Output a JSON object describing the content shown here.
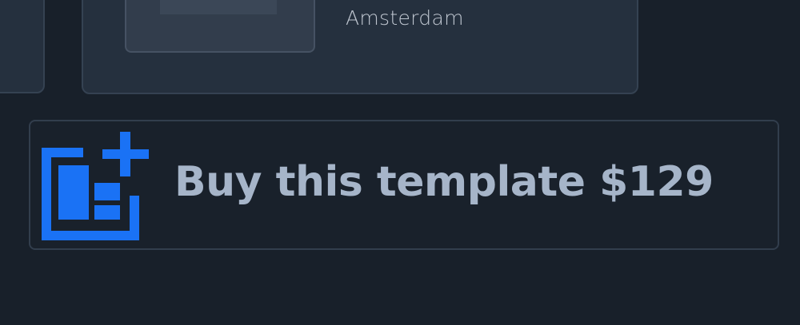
{
  "location_card": {
    "city": "Amsterdam"
  },
  "buy_banner": {
    "label": "Buy this template $129",
    "icon": "add-layout-icon",
    "accent_color": "#1a72f5"
  },
  "colors": {
    "background": "#18202a",
    "card": "#25303e",
    "label_text": "#a6b5c9"
  }
}
